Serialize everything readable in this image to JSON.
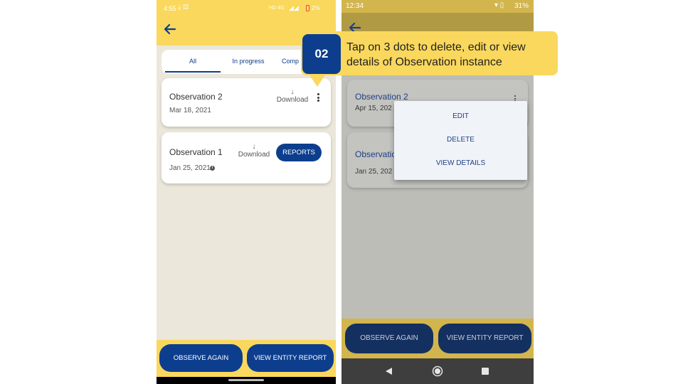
{
  "left_screen": {
    "status_bar": {
      "time": "4:55",
      "right_text": "HD 4G",
      "battery": "2%"
    },
    "tabs": [
      {
        "label": "All",
        "active": true
      },
      {
        "label": "In progress",
        "active": false
      },
      {
        "label": "Comp",
        "active": false
      }
    ],
    "observations": [
      {
        "title": "Observation 2",
        "date": "Mar 18, 2021",
        "download_label": "Download"
      },
      {
        "title": "Observation 1",
        "date": "Jan 25, 2021",
        "download_label": "Download",
        "reports_label": "REPORTS"
      }
    ],
    "footer": {
      "observe_again": "OBSERVE AGAIN",
      "view_entity_report": "VIEW ENTITY REPORT"
    }
  },
  "right_screen": {
    "status_bar": {
      "time": "12:34",
      "battery": "31%"
    },
    "observations": [
      {
        "title": "Observation 2",
        "date": "Apr 15, 202"
      },
      {
        "title": "Observation",
        "date": "Jan 25, 202"
      }
    ],
    "menu": {
      "items": [
        "EDIT",
        "DELETE",
        "VIEW DETAILS"
      ]
    },
    "footer": {
      "observe_again": "OBSERVE AGAIN",
      "view_entity_report": "VIEW ENTITY REPORT"
    }
  },
  "callout": {
    "step": "02",
    "text": "Tap on 3 dots to delete, edit or view details of Observation instance"
  },
  "colors": {
    "accent_yellow": "#FAD85D",
    "primary_blue": "#0D3E8E",
    "background_beige": "#ECE7DB"
  }
}
